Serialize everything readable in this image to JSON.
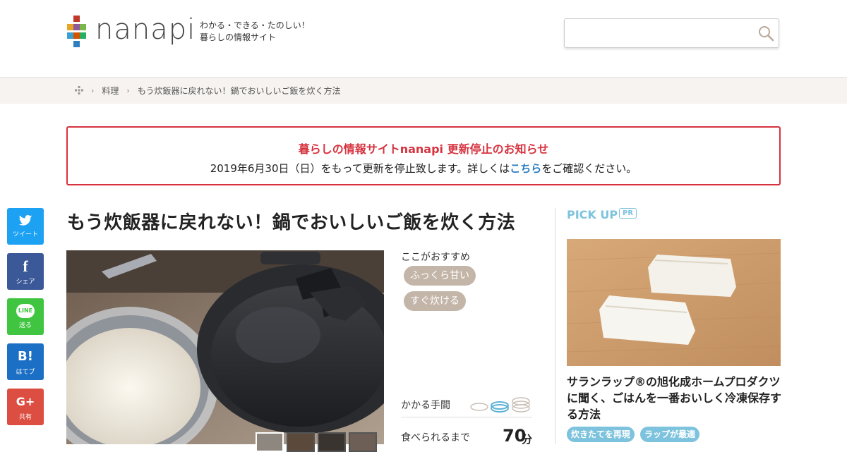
{
  "site": {
    "logo_text": "nanapi",
    "tagline_line1": "わかる・できる・たのしい！",
    "tagline_line2": "暮らしの情報サイト",
    "logo_colors": [
      "#c0392b",
      "#e6a623",
      "#2f7fbf",
      "#7ab648",
      "#8e5a9b",
      "#e67e22",
      "#3a9fd1",
      "#d35400",
      "#27ae60"
    ]
  },
  "search": {
    "placeholder": "",
    "value": ""
  },
  "breadcrumb": {
    "items": [
      "料理",
      "もう炊飯器に戻れない！鍋でおいしいご飯を炊く方法"
    ]
  },
  "notice": {
    "title": "暮らしの情報サイトnanapi 更新停止のお知らせ",
    "body_before": "2019年6月30日（日）をもって更新を停止致します。詳しくは",
    "link_text": "こちら",
    "body_after": "をご確認ください。",
    "color": "#d6333f"
  },
  "share": {
    "twitter": {
      "glyph": "🐦",
      "label": "ツイート",
      "color": "#1da1f2"
    },
    "facebook": {
      "glyph": "f",
      "label": "シェア",
      "color": "#3b5998"
    },
    "line": {
      "glyph": "LINE",
      "label": "送る",
      "color": "#3fc53f"
    },
    "hatena": {
      "glyph": "B!",
      "label": "はてブ",
      "color": "#1b6fc4"
    },
    "google": {
      "glyph": "G+",
      "label": "共有",
      "color": "#dc4e41"
    }
  },
  "article": {
    "title": "もう炊飯器に戻れない！鍋でおいしいご飯を炊く方法",
    "recommend_label": "ここがおすすめ",
    "tags": [
      "ふっくら甘い",
      "すぐ炊ける"
    ],
    "effort_label": "かかる手間",
    "effort_level": 2,
    "effort_max": 3,
    "time_label": "食べられるまで",
    "time_value": "70",
    "time_unit": "分"
  },
  "sidebar": {
    "pickup_label": "PICK UP",
    "pr_badge": "PR",
    "pick_title": "サランラップ®の旭化成ホームプロダクツに聞く、ごはんを一番おいしく冷凍保存する方法",
    "tags": [
      "炊きたてを再現",
      "ラップが最適"
    ],
    "accent": "#7dc3dd"
  }
}
